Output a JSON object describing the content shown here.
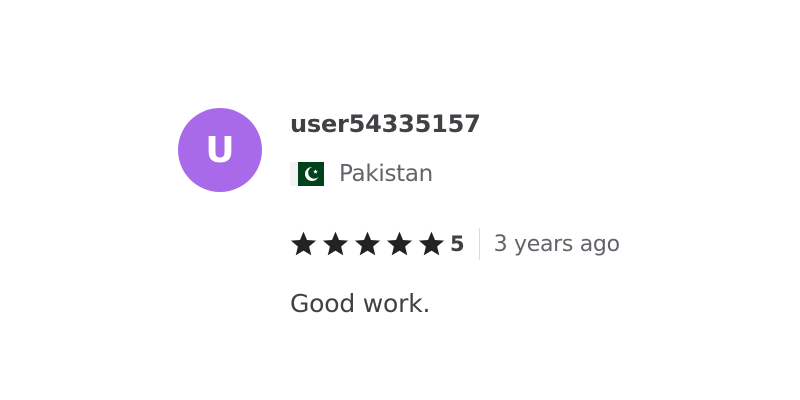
{
  "review": {
    "avatar_letter": "U",
    "avatar_color": "#a86ae8",
    "username": "user54335157",
    "country": {
      "name": "Pakistan",
      "flag_icon": "pakistan-flag-icon"
    },
    "rating": {
      "value": "5",
      "stars_filled": 5,
      "stars_total": 5,
      "star_icon": "star-icon",
      "star_color": "#222325"
    },
    "time_ago": "3 years ago",
    "text": "Good work."
  }
}
